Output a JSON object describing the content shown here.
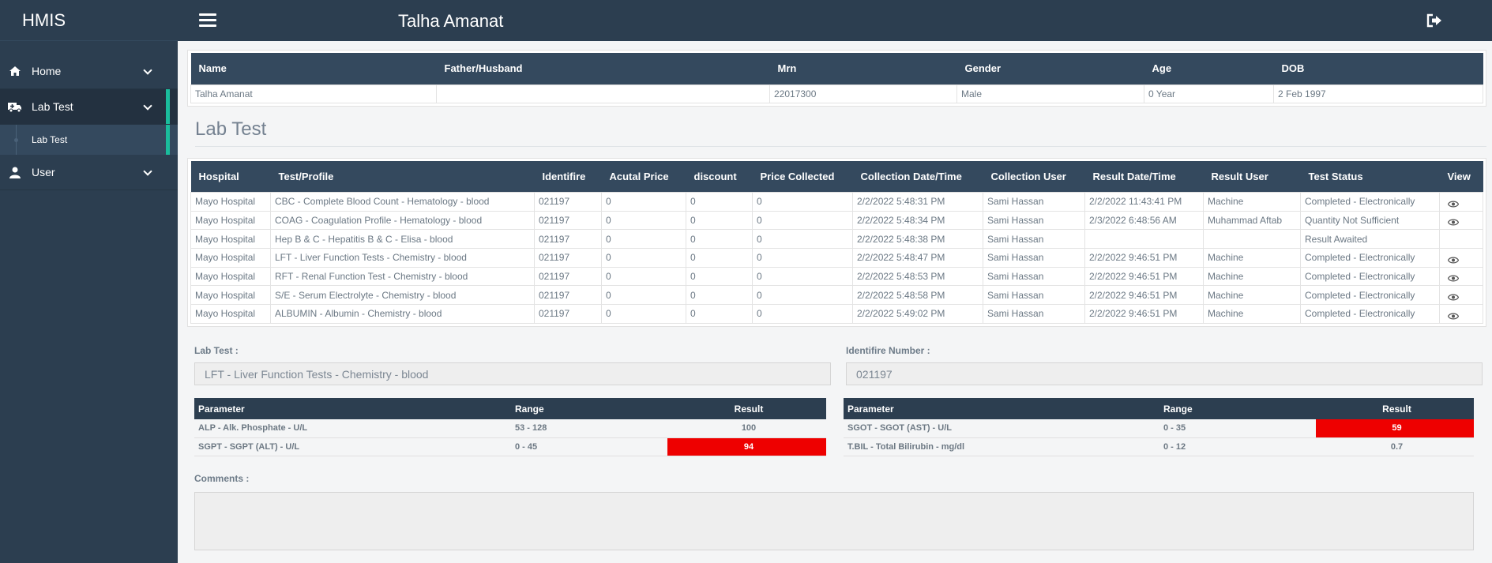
{
  "brand": "HMIS",
  "sidebar": {
    "items": [
      {
        "label": "Home",
        "icon": "home-icon"
      },
      {
        "label": "Lab Test",
        "icon": "ambulance-icon"
      },
      {
        "label": "User",
        "icon": "user-icon"
      }
    ],
    "sub_items": [
      {
        "label": "Lab Test"
      }
    ]
  },
  "header": {
    "title": "Talha Amanat"
  },
  "patient": {
    "columns": [
      "Name",
      "Father/Husband",
      "Mrn",
      "Gender",
      "Age",
      "DOB"
    ],
    "row": [
      "Talha Amanat",
      "",
      "22017300",
      "Male",
      "0 Year",
      "2 Feb 1997"
    ]
  },
  "section_title": "Lab Test",
  "lab_tests": {
    "columns": [
      "Hospital",
      "Test/Profile",
      "Identifire",
      "Acutal Price",
      "discount",
      "Price Collected",
      "Collection Date/Time",
      "Collection User",
      "Result Date/Time",
      "Result User",
      "Test Status",
      "View"
    ],
    "rows": [
      {
        "hospital": "Mayo Hospital",
        "test": "CBC - Complete Blood Count - Hematology - blood",
        "id": "021197",
        "price": "0",
        "discount": "0",
        "collected": "0",
        "coll_dt": "2/2/2022 5:48:31 PM",
        "coll_user": "Sami Hassan",
        "res_dt": "2/2/2022 11:43:41 PM",
        "res_user": "Machine",
        "status": "Completed - Electronically",
        "view": true
      },
      {
        "hospital": "Mayo Hospital",
        "test": "COAG - Coagulation Profile - Hematology - blood",
        "id": "021197",
        "price": "0",
        "discount": "0",
        "collected": "0",
        "coll_dt": "2/2/2022 5:48:34 PM",
        "coll_user": "Sami Hassan",
        "res_dt": "2/3/2022 6:48:56 AM",
        "res_user": "Muhammad Aftab",
        "status": "Quantity Not Sufficient",
        "view": true
      },
      {
        "hospital": "Mayo Hospital",
        "test": "Hep B & C - Hepatitis B & C - Elisa - blood",
        "id": "021197",
        "price": "0",
        "discount": "0",
        "collected": "0",
        "coll_dt": "2/2/2022 5:48:38 PM",
        "coll_user": "Sami Hassan",
        "res_dt": "",
        "res_user": "",
        "status": "Result Awaited",
        "view": false
      },
      {
        "hospital": "Mayo Hospital",
        "test": "LFT - Liver Function Tests - Chemistry - blood",
        "id": "021197",
        "price": "0",
        "discount": "0",
        "collected": "0",
        "coll_dt": "2/2/2022 5:48:47 PM",
        "coll_user": "Sami Hassan",
        "res_dt": "2/2/2022 9:46:51 PM",
        "res_user": "Machine",
        "status": "Completed - Electronically",
        "view": true
      },
      {
        "hospital": "Mayo Hospital",
        "test": "RFT - Renal Function Test - Chemistry - blood",
        "id": "021197",
        "price": "0",
        "discount": "0",
        "collected": "0",
        "coll_dt": "2/2/2022 5:48:53 PM",
        "coll_user": "Sami Hassan",
        "res_dt": "2/2/2022 9:46:51 PM",
        "res_user": "Machine",
        "status": "Completed - Electronically",
        "view": true
      },
      {
        "hospital": "Mayo Hospital",
        "test": "S/E - Serum Electrolyte - Chemistry - blood",
        "id": "021197",
        "price": "0",
        "discount": "0",
        "collected": "0",
        "coll_dt": "2/2/2022 5:48:58 PM",
        "coll_user": "Sami Hassan",
        "res_dt": "2/2/2022 9:46:51 PM",
        "res_user": "Machine",
        "status": "Completed - Electronically",
        "view": true
      },
      {
        "hospital": "Mayo Hospital",
        "test": "ALBUMIN - Albumin - Chemistry - blood",
        "id": "021197",
        "price": "0",
        "discount": "0",
        "collected": "0",
        "coll_dt": "2/2/2022 5:49:02 PM",
        "coll_user": "Sami Hassan",
        "res_dt": "2/2/2022 9:46:51 PM",
        "res_user": "Machine",
        "status": "Completed - Electronically",
        "view": true
      }
    ]
  },
  "form": {
    "lab_test_label": "Lab Test :",
    "lab_test_value": "LFT - Liver Function Tests - Chemistry - blood",
    "identifire_label": "Identifire Number :",
    "identifire_value": "021197",
    "comments_label": "Comments :"
  },
  "params": {
    "columns": [
      "Parameter",
      "Range",
      "Result"
    ],
    "left": [
      {
        "name": "ALP - Alk. Phosphate - U/L",
        "range": "53 - 128",
        "result": "100",
        "high": false
      },
      {
        "name": "SGPT - SGPT (ALT) - U/L",
        "range": "0 - 45",
        "result": "94",
        "high": true
      }
    ],
    "right": [
      {
        "name": "SGOT - SGOT (AST) - U/L",
        "range": "0 - 35",
        "result": "59",
        "high": true
      },
      {
        "name": "T.BIL - Total Bilirubin - mg/dl",
        "range": "0 - 12",
        "result": "0.7",
        "high": false
      }
    ]
  },
  "colors": {
    "sidebar": "#2c3e50",
    "accent": "#1abc9c",
    "high": "#ee0000"
  }
}
